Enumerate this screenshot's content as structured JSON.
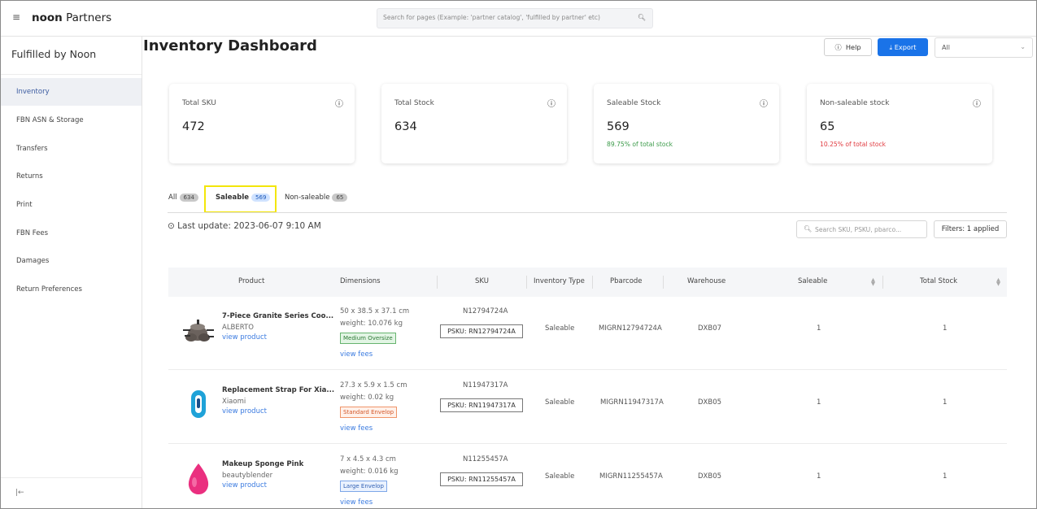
{
  "header": {
    "brand_bold": "noon",
    "brand_rest": " Partners",
    "search_placeholder": "Search for pages (Example: 'partner catalog', 'fulfilled by partner' etc)"
  },
  "sidebar": {
    "title": "Fulfilled by Noon",
    "items": [
      {
        "label": "Inventory"
      },
      {
        "label": "FBN ASN & Storage"
      },
      {
        "label": "Transfers"
      },
      {
        "label": "Returns"
      },
      {
        "label": "Print"
      },
      {
        "label": "FBN Fees"
      },
      {
        "label": "Damages"
      },
      {
        "label": "Return Preferences"
      }
    ],
    "collapse_glyph": "|←"
  },
  "page": {
    "title": "Inventory Dashboard",
    "help_label": "Help",
    "export_label": "Export",
    "select_value": "All"
  },
  "cards": [
    {
      "label": "Total SKU",
      "value": "472",
      "sub": ""
    },
    {
      "label": "Total Stock",
      "value": "634",
      "sub": ""
    },
    {
      "label": "Saleable Stock",
      "value": "569",
      "sub": "89.75% of total stock"
    },
    {
      "label": "Non-saleable stock",
      "value": "65",
      "sub": "10.25% of total stock"
    }
  ],
  "colors": {
    "sub_positive": "#3a9a48",
    "sub_negative": "#e0393e",
    "accent": "#1a73e8"
  },
  "tabs": [
    {
      "label": "All",
      "count": "634"
    },
    {
      "label": "Saleable",
      "count": "569"
    },
    {
      "label": "Non-saleable",
      "count": "65"
    }
  ],
  "toolbar": {
    "last_update": "Last update: 2023-06-07 9:10 AM",
    "search_placeholder": "Search SKU, PSKU, pbarco...",
    "filters_label": "Filters:",
    "filters_value": "1 applied"
  },
  "table": {
    "headers": {
      "product": "Product",
      "dimensions": "Dimensions",
      "sku": "SKU",
      "inventory_type": "Inventory Type",
      "pbarcode": "Pbarcode",
      "warehouse": "Warehouse",
      "saleable": "Saleable",
      "total_stock": "Total Stock"
    },
    "rows": [
      {
        "name": "7-Piece Granite Series Coo...",
        "brand": "ALBERTO",
        "view_product": "view product",
        "dimensions": "50 x 38.5 x 37.1 cm",
        "weight": "weight: 10.076 kg",
        "size_tag": "Medium Oversize",
        "view_fees": "view fees",
        "sku": "N12794724A",
        "psku": "PSKU: RN12794724A",
        "inventory_type": "Saleable",
        "pbarcode": "MIGRN12794724A",
        "warehouse": "DXB07",
        "saleable": "1",
        "total_stock": "1"
      },
      {
        "name": "Replacement Strap For Xia...",
        "brand": "Xiaomi",
        "view_product": "view product",
        "dimensions": "27.3 x 5.9 x 1.5 cm",
        "weight": "weight: 0.02 kg",
        "size_tag": "Standard Envelop",
        "view_fees": "view fees",
        "sku": "N11947317A",
        "psku": "PSKU: RN11947317A",
        "inventory_type": "Saleable",
        "pbarcode": "MIGRN11947317A",
        "warehouse": "DXB05",
        "saleable": "1",
        "total_stock": "1"
      },
      {
        "name": "Makeup Sponge Pink",
        "brand": "beautyblender",
        "view_product": "view product",
        "dimensions": "7 x 4.5 x 4.3 cm",
        "weight": "weight: 0.016 kg",
        "size_tag": "Large Envelop",
        "view_fees": "view fees",
        "sku": "N11255457A",
        "psku": "PSKU: RN11255457A",
        "inventory_type": "Saleable",
        "pbarcode": "MIGRN11255457A",
        "warehouse": "DXB05",
        "saleable": "1",
        "total_stock": "1"
      }
    ]
  }
}
